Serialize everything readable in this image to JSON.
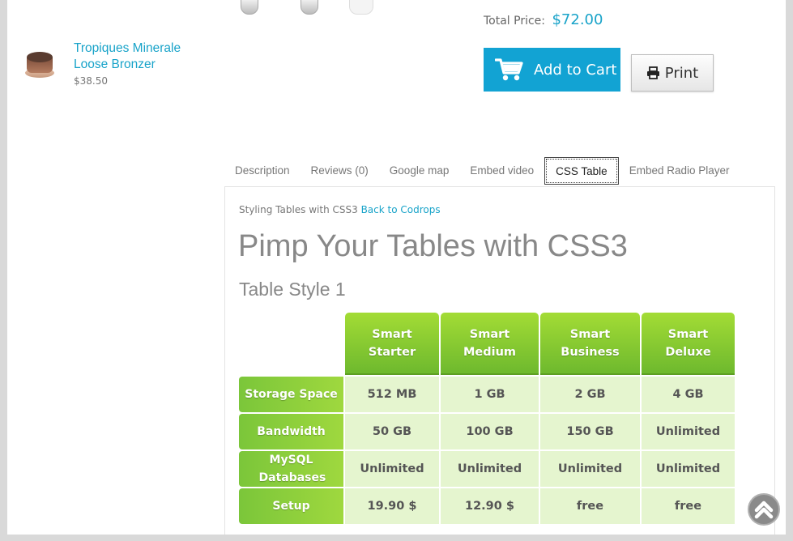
{
  "sidebar": {
    "product": {
      "title_line1": "Tropiques Minerale",
      "title_line2": "Loose Bronzer",
      "price": "$38.50"
    }
  },
  "purchase": {
    "total_label": "Total Price:",
    "total_value": "$72.00",
    "add_to_cart_label": "Add to Cart",
    "print_label": "Print"
  },
  "tabs": [
    {
      "label": "Description"
    },
    {
      "label": "Reviews (0)"
    },
    {
      "label": "Google map"
    },
    {
      "label": "Embed video"
    },
    {
      "label": "CSS Table",
      "active": true
    },
    {
      "label": "Embed Radio Player"
    }
  ],
  "content": {
    "crumb_text": "Styling Tables with CSS3",
    "crumb_link": "Back to Codrops",
    "heading": "Pimp Your Tables with CSS3",
    "subheading": "Table Style 1"
  },
  "table": {
    "columns": [
      {
        "line1": "Smart",
        "line2": "Starter"
      },
      {
        "line1": "Smart",
        "line2": "Medium"
      },
      {
        "line1": "Smart",
        "line2": "Business"
      },
      {
        "line1": "Smart",
        "line2": "Deluxe"
      }
    ],
    "rows": [
      {
        "label": "Storage Space",
        "values": [
          "512 MB",
          "1 GB",
          "2 GB",
          "4 GB"
        ]
      },
      {
        "label": "Bandwidth",
        "values": [
          "50 GB",
          "100 GB",
          "150 GB",
          "Unlimited"
        ]
      },
      {
        "label": "MySQL Databases",
        "values": [
          "Unlimited",
          "Unlimited",
          "Unlimited",
          "Unlimited"
        ]
      },
      {
        "label": "Setup",
        "values": [
          "19.90 $",
          "12.90 $",
          "free",
          "free"
        ]
      }
    ]
  },
  "colors": {
    "accent": "#18a3c9",
    "cart_button": "#12a3d3",
    "table_green": "#8fd03a",
    "table_cell": "#e5f5cf"
  },
  "icons": [
    "cart-icon",
    "printer-icon",
    "scroll-top-icon"
  ]
}
